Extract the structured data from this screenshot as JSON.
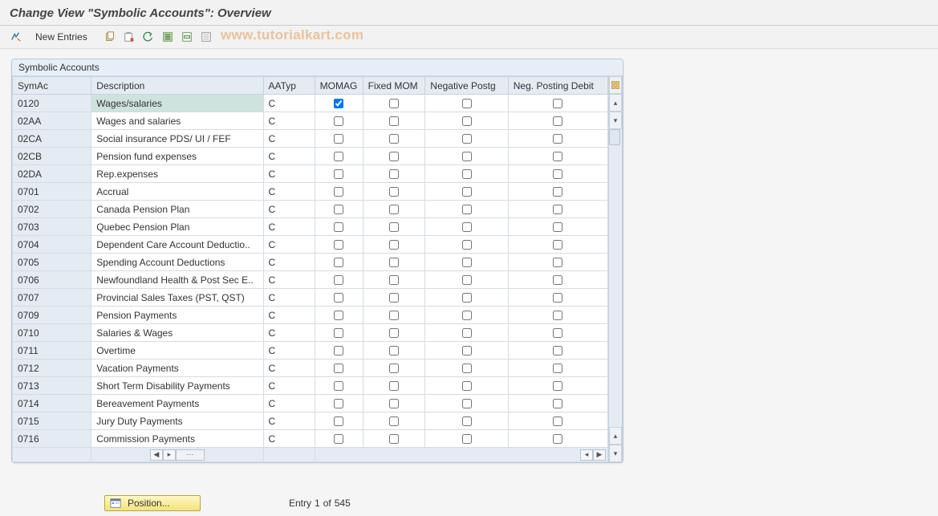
{
  "title": "Change View \"Symbolic Accounts\": Overview",
  "toolbar": {
    "new_entries": "New Entries"
  },
  "watermark": "www.tutorialkart.com",
  "panel": {
    "title": "Symbolic Accounts"
  },
  "columns": {
    "symac": "SymAc",
    "description": "Description",
    "aatyp": "AATyp",
    "momag": "MOMAG",
    "fixedmom": "Fixed MOM",
    "negpostg": "Negative Postg",
    "negdebit": "Neg. Posting Debit"
  },
  "rows": [
    {
      "symac": "0120",
      "description": "Wages/salaries",
      "aatyp": "C",
      "momag": true,
      "fixedmom": false,
      "negpostg": false,
      "negdebit": false,
      "selected": true
    },
    {
      "symac": "02AA",
      "description": "Wages and salaries",
      "aatyp": "C",
      "momag": false,
      "fixedmom": false,
      "negpostg": false,
      "negdebit": false
    },
    {
      "symac": "02CA",
      "description": "Social insurance PDS/ UI / FEF",
      "aatyp": "C",
      "momag": false,
      "fixedmom": false,
      "negpostg": false,
      "negdebit": false
    },
    {
      "symac": "02CB",
      "description": "Pension fund expenses",
      "aatyp": "C",
      "momag": false,
      "fixedmom": false,
      "negpostg": false,
      "negdebit": false
    },
    {
      "symac": "02DA",
      "description": "Rep.expenses",
      "aatyp": "C",
      "momag": false,
      "fixedmom": false,
      "negpostg": false,
      "negdebit": false
    },
    {
      "symac": "0701",
      "description": "Accrual",
      "aatyp": "C",
      "momag": false,
      "fixedmom": false,
      "negpostg": false,
      "negdebit": false
    },
    {
      "symac": "0702",
      "description": "Canada Pension Plan",
      "aatyp": "C",
      "momag": false,
      "fixedmom": false,
      "negpostg": false,
      "negdebit": false
    },
    {
      "symac": "0703",
      "description": "Quebec Pension Plan",
      "aatyp": "C",
      "momag": false,
      "fixedmom": false,
      "negpostg": false,
      "negdebit": false
    },
    {
      "symac": "0704",
      "description": "Dependent Care Account Deductio..",
      "aatyp": "C",
      "momag": false,
      "fixedmom": false,
      "negpostg": false,
      "negdebit": false
    },
    {
      "symac": "0705",
      "description": "Spending Account Deductions",
      "aatyp": "C",
      "momag": false,
      "fixedmom": false,
      "negpostg": false,
      "negdebit": false
    },
    {
      "symac": "0706",
      "description": "Newfoundland Health & Post Sec E..",
      "aatyp": "C",
      "momag": false,
      "fixedmom": false,
      "negpostg": false,
      "negdebit": false
    },
    {
      "symac": "0707",
      "description": "Provincial Sales Taxes (PST, QST)",
      "aatyp": "C",
      "momag": false,
      "fixedmom": false,
      "negpostg": false,
      "negdebit": false
    },
    {
      "symac": "0709",
      "description": "Pension Payments",
      "aatyp": "C",
      "momag": false,
      "fixedmom": false,
      "negpostg": false,
      "negdebit": false
    },
    {
      "symac": "0710",
      "description": "Salaries & Wages",
      "aatyp": "C",
      "momag": false,
      "fixedmom": false,
      "negpostg": false,
      "negdebit": false
    },
    {
      "symac": "0711",
      "description": "Overtime",
      "aatyp": "C",
      "momag": false,
      "fixedmom": false,
      "negpostg": false,
      "negdebit": false
    },
    {
      "symac": "0712",
      "description": "Vacation Payments",
      "aatyp": "C",
      "momag": false,
      "fixedmom": false,
      "negpostg": false,
      "negdebit": false
    },
    {
      "symac": "0713",
      "description": "Short Term Disability Payments",
      "aatyp": "C",
      "momag": false,
      "fixedmom": false,
      "negpostg": false,
      "negdebit": false
    },
    {
      "symac": "0714",
      "description": "Bereavement Payments",
      "aatyp": "C",
      "momag": false,
      "fixedmom": false,
      "negpostg": false,
      "negdebit": false
    },
    {
      "symac": "0715",
      "description": "Jury Duty Payments",
      "aatyp": "C",
      "momag": false,
      "fixedmom": false,
      "negpostg": false,
      "negdebit": false
    },
    {
      "symac": "0716",
      "description": "Commission Payments",
      "aatyp": "C",
      "momag": false,
      "fixedmom": false,
      "negpostg": false,
      "negdebit": false
    }
  ],
  "footer": {
    "position_label": "Position...",
    "entry_prefix": "Entry",
    "entry_current": "1",
    "entry_of": "of",
    "entry_total": "545"
  }
}
